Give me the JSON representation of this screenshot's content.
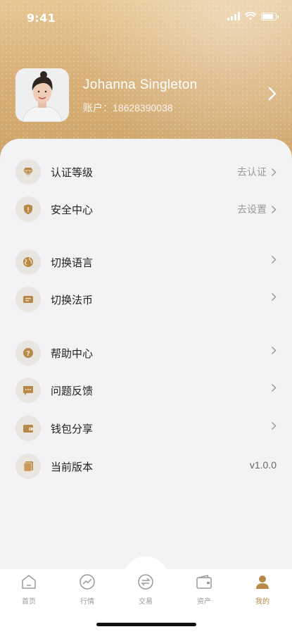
{
  "status_bar": {
    "time": "9:41"
  },
  "profile": {
    "name": "Johanna Singleton",
    "account_label": "账户：",
    "account": "18628390038"
  },
  "menu": [
    {
      "label": "认证等级",
      "value": "去认证",
      "icon": "diamond-icon"
    },
    {
      "label": "安全中心",
      "value": "去设置",
      "icon": "shield-icon"
    },
    {
      "label": "切换语言",
      "value": "",
      "icon": "globe-icon"
    },
    {
      "label": "切换法币",
      "value": "",
      "icon": "currency-icon"
    },
    {
      "label": "帮助中心",
      "value": "",
      "icon": "help-icon"
    },
    {
      "label": "问题反馈",
      "value": "",
      "icon": "feedback-icon"
    },
    {
      "label": "钱包分享",
      "value": "",
      "icon": "wallet-icon"
    },
    {
      "label": "当前版本",
      "value": "v1.0.0",
      "icon": "book-icon"
    }
  ],
  "tabs": [
    {
      "label": "首页",
      "icon": "home-icon"
    },
    {
      "label": "行情",
      "icon": "chart-icon"
    },
    {
      "label": "交易",
      "icon": "exchange-icon"
    },
    {
      "label": "资产",
      "icon": "wallet-tab-icon"
    },
    {
      "label": "我的",
      "icon": "user-icon",
      "active": true
    }
  ],
  "colors": {
    "accent": "#b88a4a",
    "header_gradient_top": "#e6c793",
    "header_gradient_bottom": "#c9a062"
  }
}
